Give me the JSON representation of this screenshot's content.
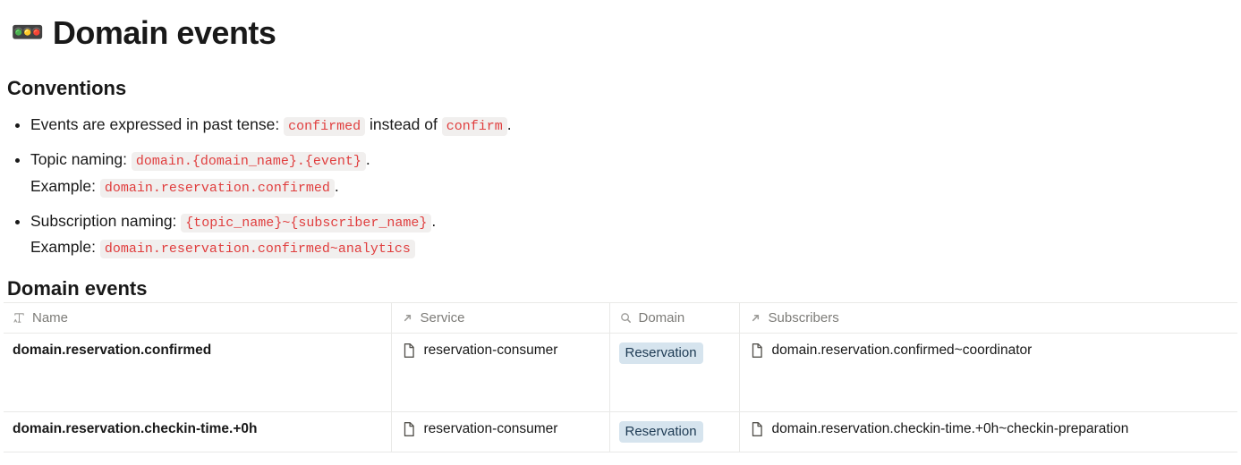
{
  "page": {
    "emoji": "🚥",
    "title": "Domain events"
  },
  "conventions": {
    "heading": "Conventions",
    "items": [
      {
        "prefix": "Events are expressed in past tense: ",
        "code1": "confirmed",
        "mid": " instead of ",
        "code2": "confirm",
        "suffix": "."
      },
      {
        "prefix": "Topic naming: ",
        "code1": "domain.{domain_name}.{event}",
        "suffix": ".",
        "example_prefix": "Example: ",
        "example_code": "domain.reservation.confirmed",
        "example_suffix": "."
      },
      {
        "prefix": "Subscription naming: ",
        "code1": "{topic_name}~{subscriber_name}",
        "suffix": ".",
        "example_prefix": "Example: ",
        "example_code": "domain.reservation.confirmed~analytics"
      }
    ]
  },
  "table": {
    "heading": "Domain events",
    "columns": {
      "name": "Name",
      "service": "Service",
      "domain": "Domain",
      "subscribers": "Subscribers"
    },
    "rows": [
      {
        "name": "domain.reservation.confirmed",
        "service": "reservation-consumer",
        "domain": "Reservation",
        "subscriber": "domain.reservation.confirmed~coordinator"
      },
      {
        "name": "domain.reservation.checkin-time.+0h",
        "service": "reservation-consumer",
        "domain": "Reservation",
        "subscriber": "domain.reservation.checkin-time.+0h~checkin-preparation"
      }
    ]
  }
}
